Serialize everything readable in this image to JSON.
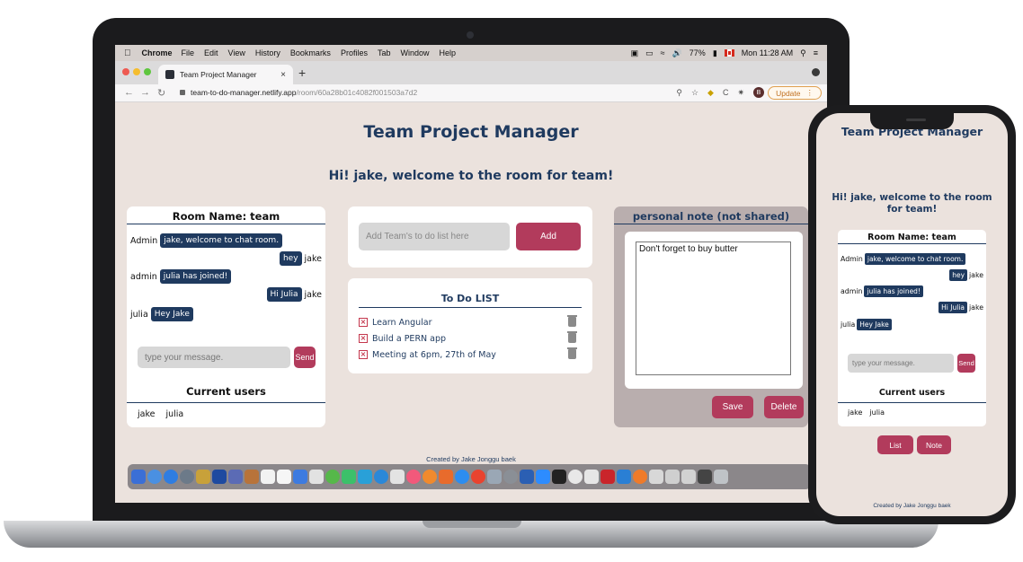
{
  "menubar": {
    "app": "Chrome",
    "items": [
      "File",
      "Edit",
      "View",
      "History",
      "Bookmarks",
      "Profiles",
      "Tab",
      "Window",
      "Help"
    ],
    "battery": "77%",
    "clock": "Mon 11:28 AM"
  },
  "browser": {
    "tab_title": "Team Project Manager",
    "url_host": "team-to-do-manager.netlify.app",
    "url_path": "/room/60a28b01c4082f001503a7d2",
    "update_label": "Update",
    "profile_initial": "B"
  },
  "app": {
    "title": "Team Project Manager",
    "welcome": "Hi! jake, welcome to the room for team!",
    "chat": {
      "room_name": "Room Name: team",
      "messages": [
        {
          "sender": "Admin",
          "text": "jake, welcome to chat room."
        },
        {
          "sender": "jake",
          "text": "hey"
        },
        {
          "sender": "admin",
          "text": "julia has joined!"
        },
        {
          "sender": "jake",
          "text": "Hi Julia"
        },
        {
          "sender": "julia",
          "text": "Hey Jake"
        }
      ],
      "input_placeholder": "type your message.",
      "send_label": "Send",
      "users_heading": "Current users",
      "users": [
        "jake",
        "julia"
      ]
    },
    "todo": {
      "input_placeholder": "Add Team's to do list here",
      "add_label": "Add",
      "list_title": "To Do LIST",
      "items": [
        "Learn Angular",
        "Build a PERN app",
        "Meeting at 6pm, 27th of May"
      ]
    },
    "note": {
      "heading": "personal note (not shared)",
      "text": "Don't forget to buy butter",
      "save_label": "Save",
      "delete_label": "Delete"
    },
    "footer": "Created by Jake Jonggu baek"
  },
  "phone": {
    "title": "Team Project Manager",
    "welcome": "Hi! jake, welcome to the room for team!",
    "list_label": "List",
    "note_label": "Note",
    "footer": "Created by Jake Jonggu baek"
  },
  "colors": {
    "navy": "#1f3a5f",
    "accent": "#b23b5c",
    "background": "#ebe2dd"
  }
}
